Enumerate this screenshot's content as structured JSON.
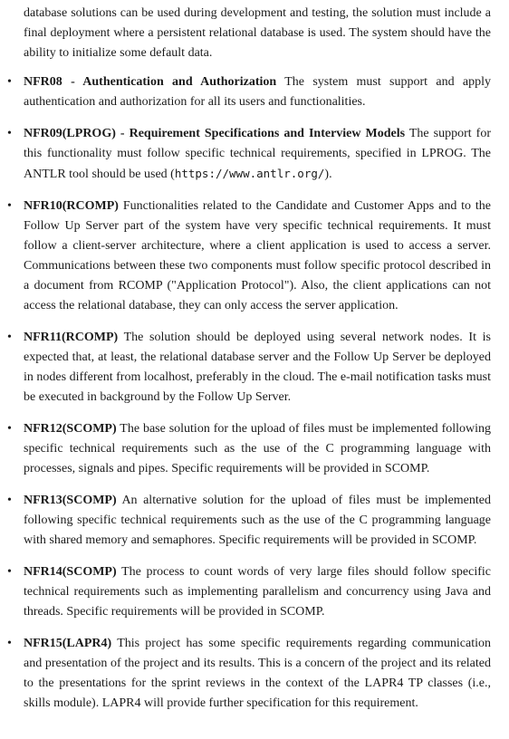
{
  "intro": {
    "text": "database solutions can be used during development and testing, the solution must include a final deployment where a persistent relational database is used. The system should have the ability to initialize some default data."
  },
  "requirements": [
    {
      "title": "NFR08 - Authentication and Authorization",
      "text": "The system must support and apply authentication and authorization for all its users and functionalities."
    },
    {
      "title": "NFR09(LPROG) - Requirement Specifications and Interview Models",
      "text": "The support for this functionality must follow specific technical requirements, specified in LPROG. The ANTLR tool should be used (",
      "url": "https://www.antlr.org/",
      "text_after": ")."
    },
    {
      "title": "NFR10(RCOMP)",
      "text": "Functionalities related to the Candidate and Customer Apps and to the Follow Up Server part of the system have very specific technical requirements. It must follow a client-server architecture, where a client application is used to access a server. Communications between these two components must follow specific protocol described in a document from RCOMP (\"Application Protocol\"). Also, the client applications can not access the relational database, they can only access the server application."
    },
    {
      "title": "NFR11(RCOMP)",
      "text": "The solution should be deployed using several network nodes. It is expected that, at least, the relational database server and the Follow Up Server be deployed in nodes different from localhost, preferably in the cloud. The e-mail notification tasks must be executed in background by the Follow Up Server."
    },
    {
      "title": "NFR12(SCOMP)",
      "text": "The base solution for the upload of files must be implemented following specific technical requirements such as the use of the C programming language with processes, signals and pipes. Specific requirements will be provided in SCOMP."
    },
    {
      "title": "NFR13(SCOMP)",
      "text": "An alternative solution for the upload of files must be implemented following specific technical requirements such as the use of the C programming language with shared memory and semaphores. Specific requirements will be provided in SCOMP."
    },
    {
      "title": "NFR14(SCOMP)",
      "text": "The process to count words of very large files should follow specific technical requirements such as implementing parallelism and concurrency using Java and threads. Specific requirements will be provided in SCOMP."
    },
    {
      "title": "NFR15(LAPR4)",
      "text": "This project has some specific requirements regarding communication and presentation of the project and its results. This is a concern of the project and its related to the presentations for the sprint reviews in the context of the LAPR4 TP classes (i.e., skills module). LAPR4 will provide further specification for this requirement."
    }
  ]
}
